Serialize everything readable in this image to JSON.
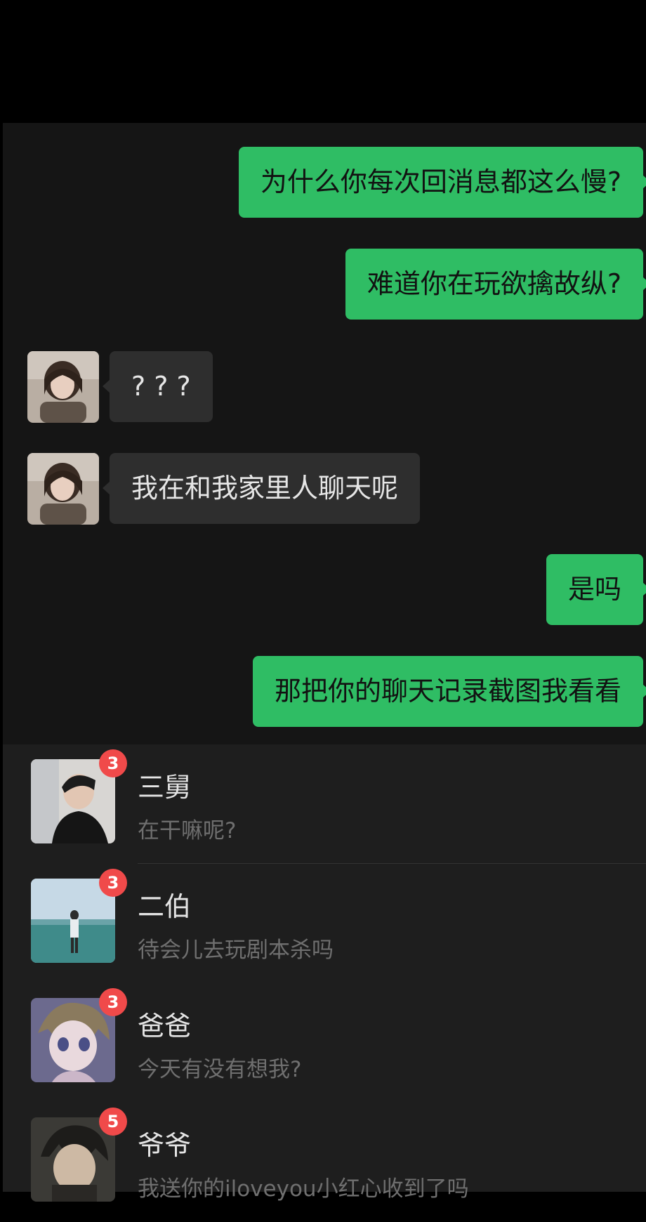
{
  "chat": {
    "messages": [
      {
        "side": "out",
        "text": "为什么你每次回消息都这么慢?"
      },
      {
        "side": "out",
        "text": "难道你在玩欲擒故纵?"
      },
      {
        "side": "in",
        "text": "? ? ?"
      },
      {
        "side": "in",
        "text": "我在和我家里人聊天呢"
      },
      {
        "side": "out",
        "text": "是吗"
      },
      {
        "side": "out",
        "text": "那把你的聊天记录截图我看看"
      }
    ]
  },
  "contacts": [
    {
      "name": "三舅",
      "preview": "在干嘛呢?",
      "unread": "3"
    },
    {
      "name": "二伯",
      "preview": "待会儿去玩剧本杀吗",
      "unread": "3"
    },
    {
      "name": "爸爸",
      "preview": "今天有没有想我?",
      "unread": "3"
    },
    {
      "name": "爷爷",
      "preview": "我送你的iloveyou小红心收到了吗",
      "unread": "5"
    }
  ],
  "colors": {
    "outgoing_bubble": "#2fbd64",
    "incoming_bubble": "#2e2e2e",
    "unread_badge": "#f04a4a"
  }
}
